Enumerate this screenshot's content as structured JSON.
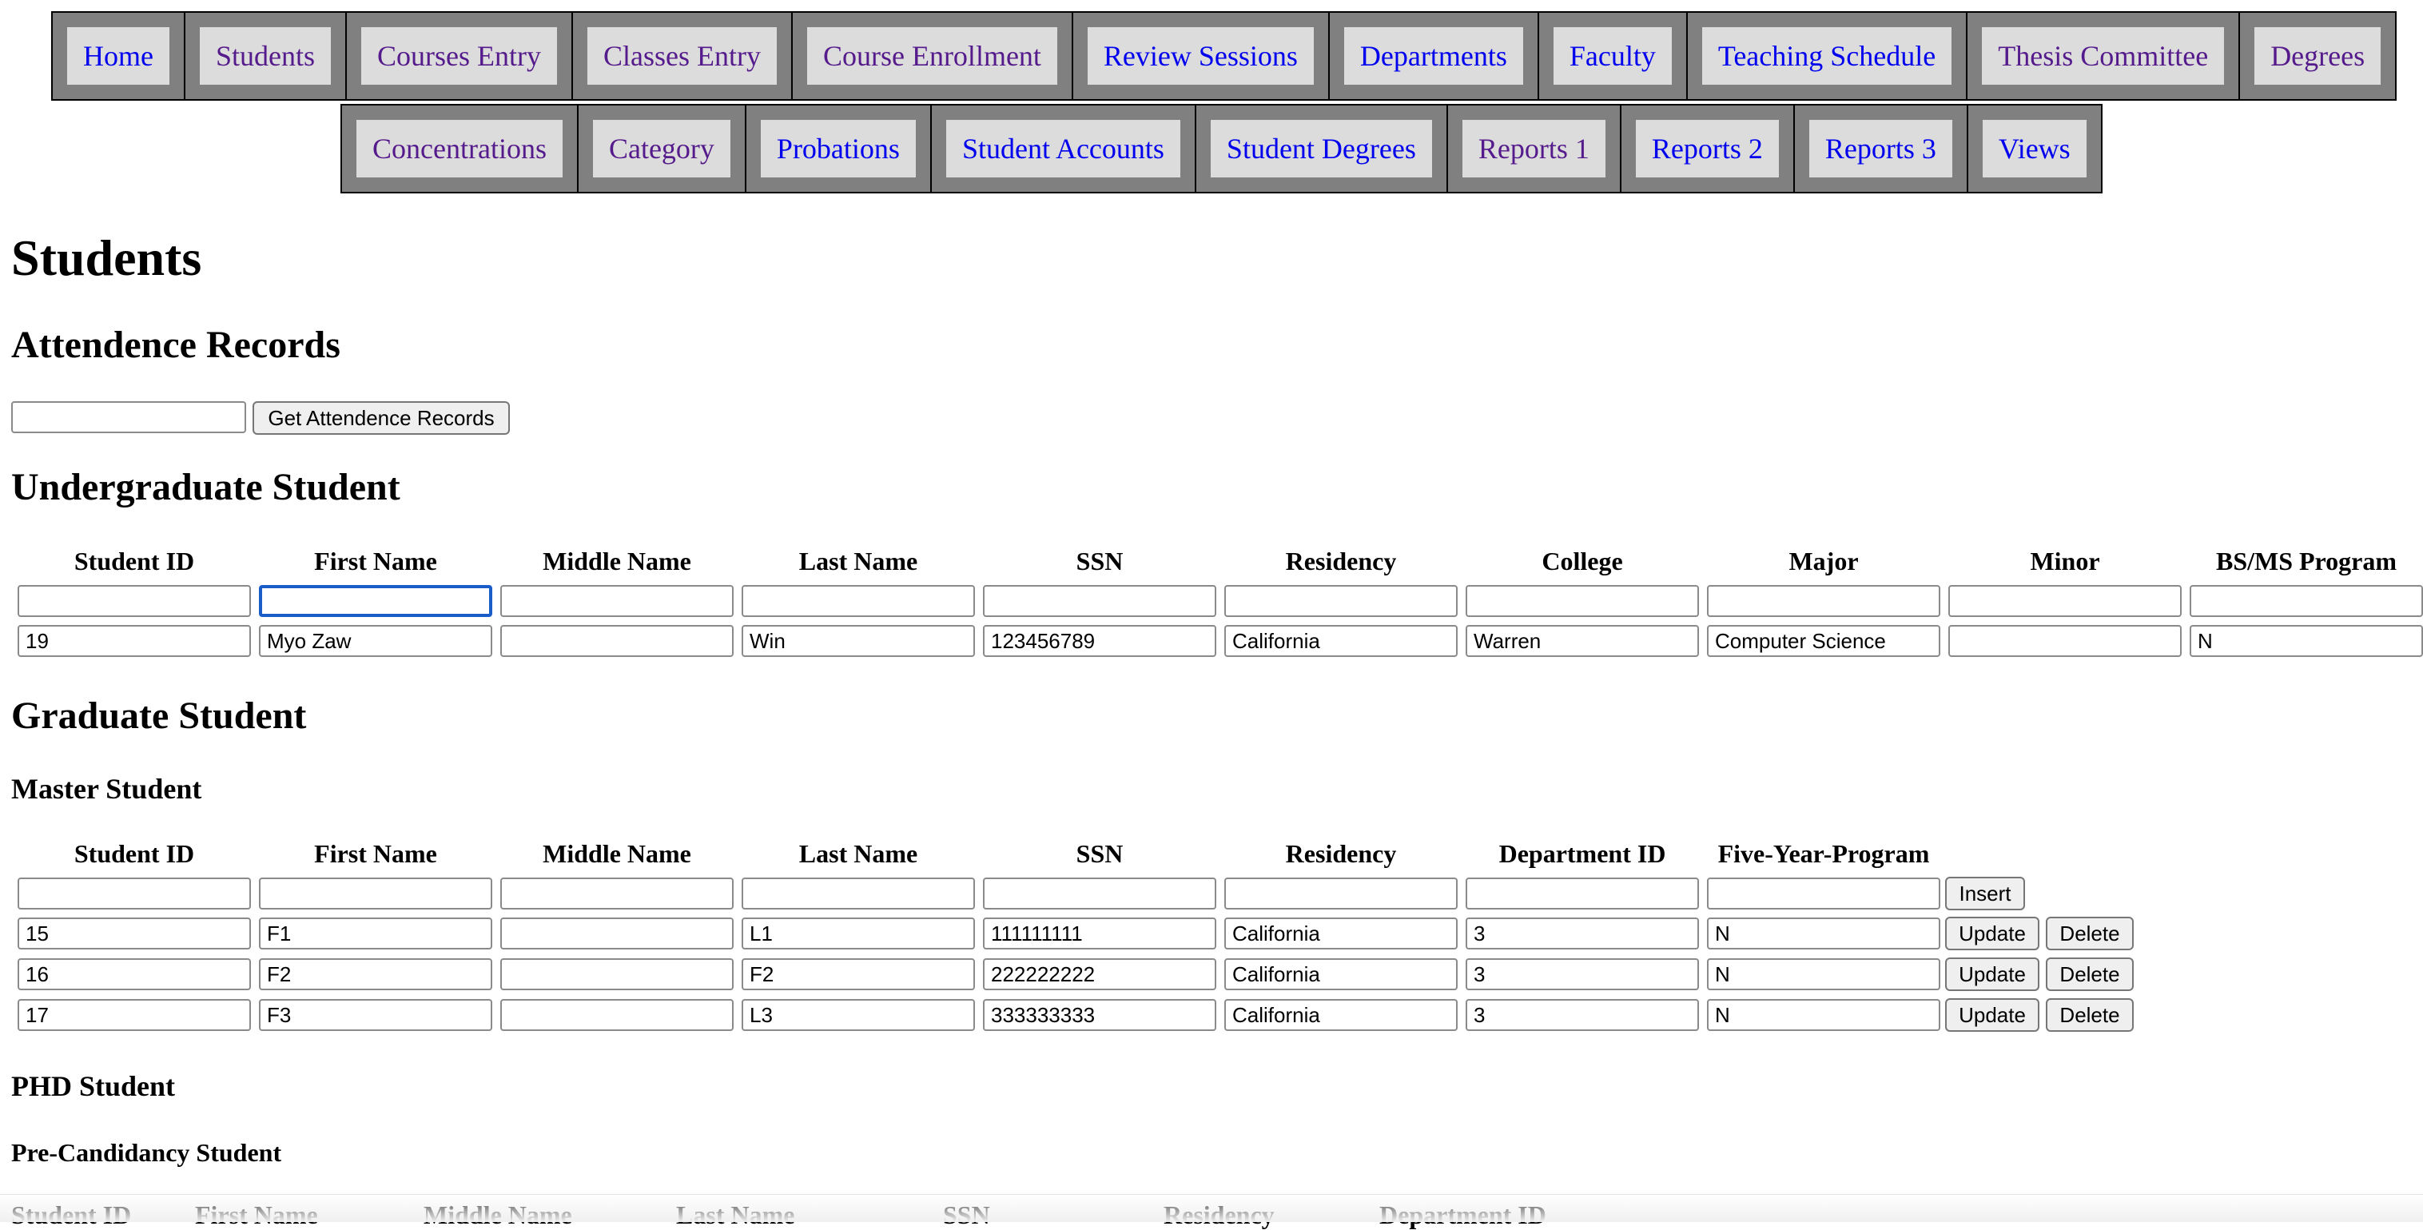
{
  "nav": {
    "row1": [
      {
        "label": "Home",
        "visited": false
      },
      {
        "label": "Students",
        "visited": true
      },
      {
        "label": "Courses Entry",
        "visited": true
      },
      {
        "label": "Classes Entry",
        "visited": true
      },
      {
        "label": "Course Enrollment",
        "visited": true
      },
      {
        "label": "Review Sessions",
        "visited": false
      },
      {
        "label": "Departments",
        "visited": false
      },
      {
        "label": "Faculty",
        "visited": false
      },
      {
        "label": "Teaching Schedule",
        "visited": false
      },
      {
        "label": "Thesis Committee",
        "visited": true
      },
      {
        "label": "Degrees",
        "visited": true
      }
    ],
    "row2": [
      {
        "label": "Concentrations",
        "visited": true
      },
      {
        "label": "Category",
        "visited": true
      },
      {
        "label": "Probations",
        "visited": false
      },
      {
        "label": "Student Accounts",
        "visited": false
      },
      {
        "label": "Student Degrees",
        "visited": false
      },
      {
        "label": "Reports 1",
        "visited": true
      },
      {
        "label": "Reports 2",
        "visited": false
      },
      {
        "label": "Reports 3",
        "visited": false
      },
      {
        "label": "Views",
        "visited": false
      }
    ]
  },
  "page_title": "Students",
  "attendance": {
    "heading": "Attendence Records",
    "input_value": "",
    "button_label": "Get Attendence Records"
  },
  "undergrad": {
    "heading": "Undergraduate Student",
    "columns": [
      "Student ID",
      "First Name",
      "Middle Name",
      "Last Name",
      "SSN",
      "Residency",
      "College",
      "Major",
      "Minor",
      "BS/MS Program"
    ],
    "new_row": [
      "",
      "",
      "",
      "",
      "",
      "",
      "",
      "",
      "",
      ""
    ],
    "rows": [
      [
        "19",
        "Myo Zaw",
        "",
        "Win",
        "123456789",
        "California",
        "Warren",
        "Computer Science",
        "",
        "N"
      ]
    ]
  },
  "graduate": {
    "heading": "Graduate Student",
    "master": {
      "heading": "Master Student",
      "columns": [
        "Student ID",
        "First Name",
        "Middle Name",
        "Last Name",
        "SSN",
        "Residency",
        "Department ID",
        "Five-Year-Program"
      ],
      "new_row": [
        "",
        "",
        "",
        "",
        "",
        "",
        "",
        ""
      ],
      "insert_label": "Insert",
      "update_label": "Update",
      "delete_label": "Delete",
      "rows": [
        [
          "15",
          "F1",
          "",
          "L1",
          "111111111",
          "California",
          "3",
          "N"
        ],
        [
          "16",
          "F2",
          "",
          "F2",
          "222222222",
          "California",
          "3",
          "N"
        ],
        [
          "17",
          "F3",
          "",
          "L3",
          "333333333",
          "California",
          "3",
          "N"
        ]
      ]
    },
    "phd": {
      "heading": "PHD Student",
      "precandidacy": {
        "heading": "Pre-Candidancy Student",
        "columns": [
          "Student ID",
          "First Name",
          "Middle Name",
          "Last Name",
          "SSN",
          "Residency",
          "Department ID"
        ]
      }
    }
  }
}
